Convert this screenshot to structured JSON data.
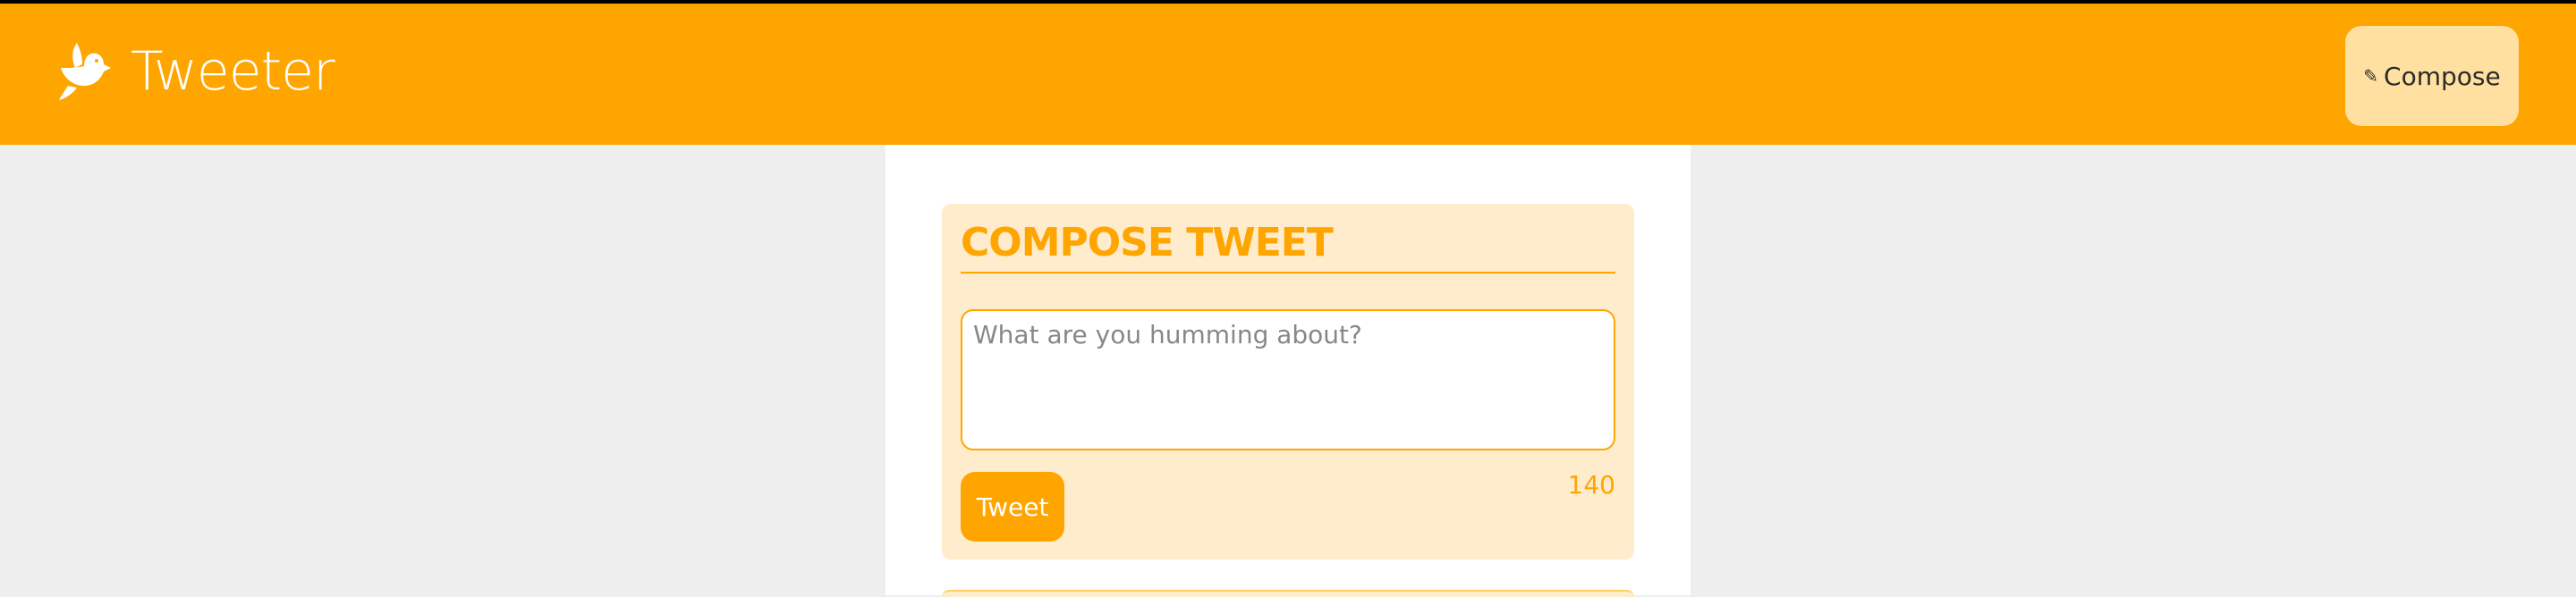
{
  "header": {
    "brand_icon": "dove-icon",
    "brand_title": "Tweeter",
    "compose_label": "Compose",
    "compose_icon": "edit-icon",
    "colors": {
      "bar": "#ffa500",
      "compose_button_bg": "#ffe0a0"
    }
  },
  "compose": {
    "heading": "COMPOSE TWEET",
    "placeholder": "What are you humming about?",
    "value": "",
    "submit_label": "Tweet",
    "char_count": "140",
    "colors": {
      "accent": "#ffa500",
      "panel_bg": "#ffeccc"
    }
  }
}
